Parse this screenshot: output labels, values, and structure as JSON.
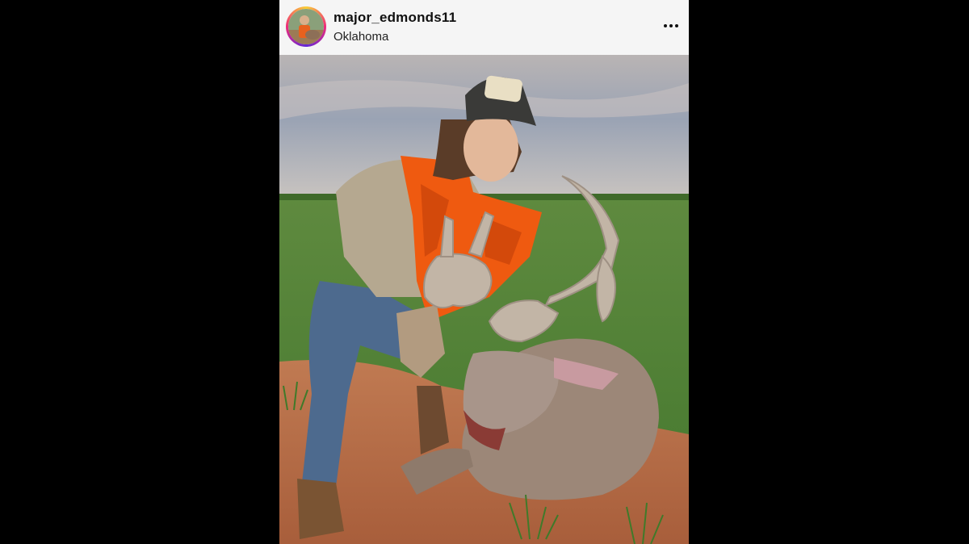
{
  "post": {
    "username": "major_edmonds11",
    "location": "Oklahoma",
    "avatar_icon": "user-avatar",
    "more_icon": "more-options-icon",
    "photo_alt": "Hunter in an orange camouflage vest kneeling in a green field behind a harvested deer with large antlers"
  }
}
